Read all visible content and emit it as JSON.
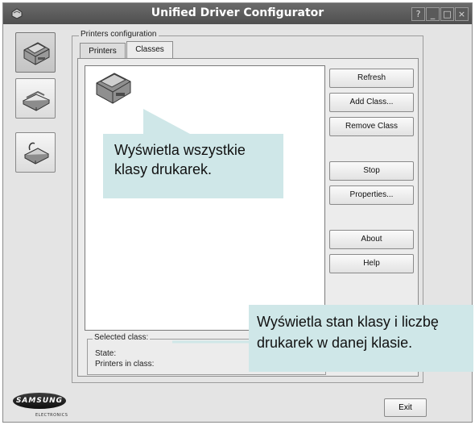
{
  "window": {
    "title": "Unified Driver Configurator",
    "controls": {
      "help": "?",
      "minimize": "_",
      "maximize": "□",
      "close": "×"
    }
  },
  "sidebar": {
    "items": [
      {
        "name": "printers",
        "icon": "printer-icon",
        "active": true
      },
      {
        "name": "scanners",
        "icon": "scanner-icon",
        "active": false
      },
      {
        "name": "ports",
        "icon": "port-icon",
        "active": false
      }
    ]
  },
  "main": {
    "frame_label": "Printers configuration",
    "tabs": [
      {
        "label": "Printers",
        "active": false
      },
      {
        "label": "Classes",
        "active": true
      }
    ],
    "buttons": {
      "refresh": "Refresh",
      "add_class": "Add Class...",
      "remove_class": "Remove Class",
      "stop": "Stop",
      "properties": "Properties...",
      "about": "About",
      "help": "Help"
    },
    "selected_class": {
      "legend": "Selected class:",
      "state_label": "State:",
      "printers_label": "Printers in class:"
    }
  },
  "callouts": {
    "classes_list": "Wyświetla wszystkie klasy drukarek.",
    "class_state": "Wyświetla stan klasy i liczbę drukarek w danej klasie."
  },
  "footer": {
    "exit": "Exit",
    "brand": "SAMSUNG",
    "brand_sub": "ELECTRONICS"
  },
  "colors": {
    "titlebar": "#5a5a5a",
    "window_bg": "#e4e4e4",
    "callout_bg": "#cfe7e8"
  }
}
